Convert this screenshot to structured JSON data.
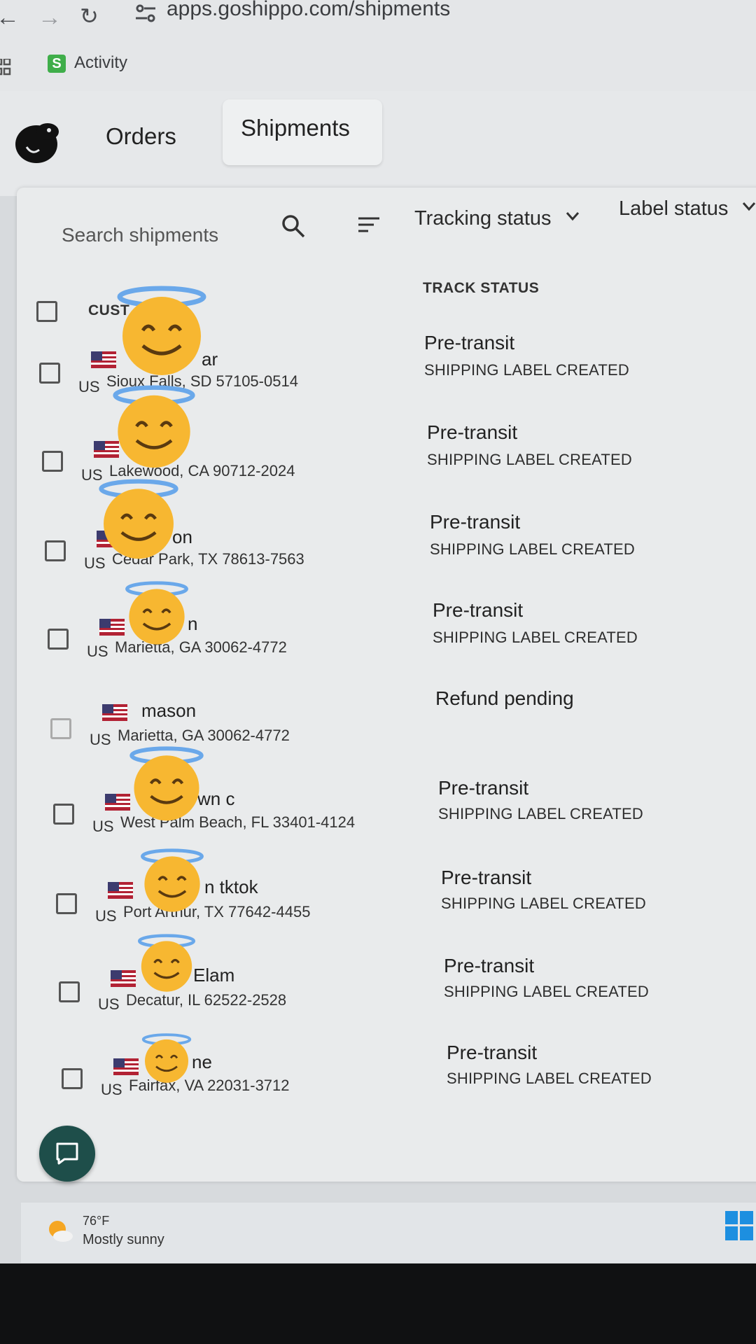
{
  "browser": {
    "url": "apps.goshippo.com/shipments",
    "bookmark_label": "Activity",
    "bookmark_badge": "S"
  },
  "app": {
    "tabs": [
      {
        "label": "Orders",
        "active": false
      },
      {
        "label": "Shipments",
        "active": true
      }
    ]
  },
  "toolbar": {
    "search_placeholder": "Search shipments",
    "tracking_filter": "Tracking status",
    "label_filter": "Label status"
  },
  "table": {
    "headers": {
      "customer": "CUST",
      "track_status": "TRACK STATUS"
    },
    "rows": [
      {
        "name": "ar",
        "country": "US",
        "city": "Sioux Falls, SD 57105-0514",
        "status": "Pre-transit",
        "substatus": "SHIPPING LABEL CREATED"
      },
      {
        "name": "",
        "country": "US",
        "city": "Lakewood, CA 90712-2024",
        "status": "Pre-transit",
        "substatus": "SHIPPING LABEL CREATED"
      },
      {
        "name": "on",
        "country": "US",
        "city": "Cedar Park, TX 78613-7563",
        "status": "Pre-transit",
        "substatus": "SHIPPING LABEL CREATED"
      },
      {
        "name": "n",
        "country": "US",
        "city": "Marietta, GA 30062-4772",
        "status": "Pre-transit",
        "substatus": "SHIPPING LABEL CREATED"
      },
      {
        "name": "mason",
        "country": "US",
        "city": "Marietta, GA 30062-4772",
        "status": "Refund pending",
        "substatus": ""
      },
      {
        "name": "wn c",
        "country": "US",
        "city": "West Palm Beach, FL 33401-4124",
        "status": "Pre-transit",
        "substatus": "SHIPPING LABEL CREATED"
      },
      {
        "name": "n tktok",
        "country": "US",
        "city": "Port Arthur, TX 77642-4455",
        "status": "Pre-transit",
        "substatus": "SHIPPING LABEL CREATED"
      },
      {
        "name": "Elam",
        "country": "US",
        "city": "Decatur, IL 62522-2528",
        "status": "Pre-transit",
        "substatus": "SHIPPING LABEL CREATED"
      },
      {
        "name": "ne",
        "country": "US",
        "city": "Fairfax, VA 22031-3712",
        "status": "Pre-transit",
        "substatus": "SHIPPING LABEL CREATED"
      }
    ]
  },
  "taskbar": {
    "temperature": "76°F",
    "weather": "Mostly sunny"
  },
  "colors": {
    "chat_button": "#1e4e4a",
    "bookmark_green": "#3fae4a",
    "emoji_face": "#f7b731",
    "halo": "#6aa8ea"
  },
  "icons": [
    "back-icon",
    "forward-icon",
    "reload-icon",
    "site-settings-icon",
    "apps-icon",
    "shippo-logo",
    "search-icon",
    "sort-icon",
    "chevron-down-icon",
    "chat-icon",
    "weather-icon",
    "windows-start-icon",
    "smiling-halo-emoji"
  ]
}
